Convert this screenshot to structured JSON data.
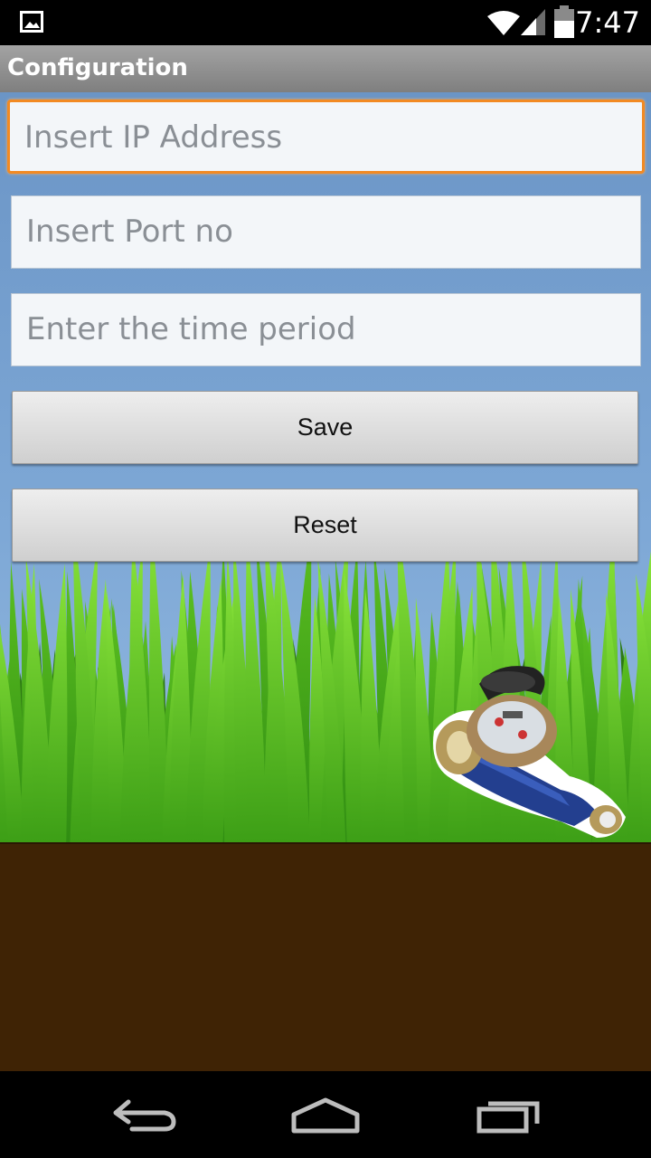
{
  "status_bar": {
    "time": "7:47"
  },
  "app_bar": {
    "title": "Configuration"
  },
  "form": {
    "ip_placeholder": "Insert IP Address",
    "port_placeholder": "Insert Port no",
    "time_placeholder": "Enter the time period",
    "save_label": "Save",
    "reset_label": "Reset"
  },
  "nav_bar": {
    "icons": [
      "back-icon",
      "home-icon",
      "recents-icon"
    ]
  },
  "colors": {
    "focus": "#f28a23",
    "soil": "#3f2305",
    "grass": "#4fb51c",
    "sky": "#7ea8d6"
  }
}
